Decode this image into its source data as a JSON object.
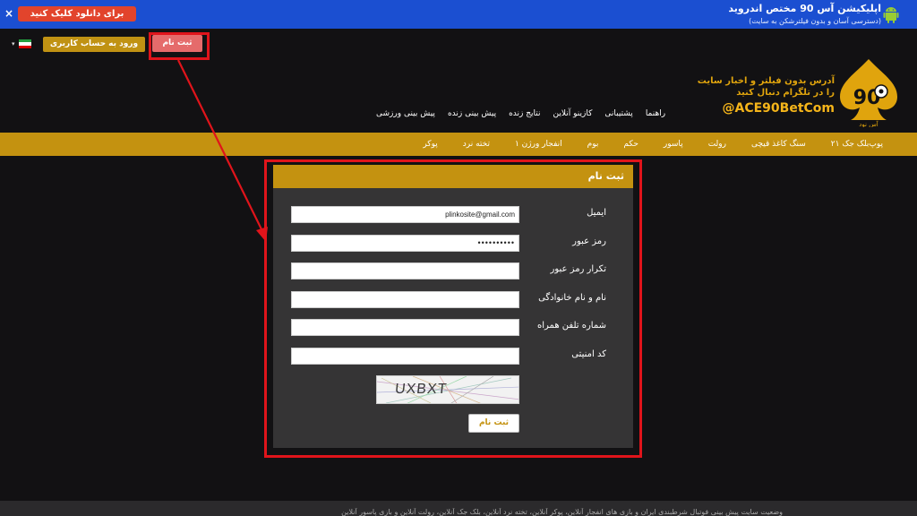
{
  "app_banner": {
    "title": "اپلیکیشن آس 90 مختص اندروید",
    "subtitle": "(دسترسی آسان و بدون فیلترشکن به سایت)",
    "download_button": "برای دانلود کلیک کنید",
    "close_glyph": "×",
    "bg_color": "#1b4fd1"
  },
  "header": {
    "register_button": "ثبت نام",
    "login_button": "ورود به حساب کاربری",
    "language_caret": "▾",
    "logo": {
      "line1": "آدرس بدون فیلتر و اخبار سایت",
      "line2": "را در تلگرام دنبال کنید",
      "handle": "@ACE90BetCom",
      "brand_text": "آس نود"
    },
    "nav": [
      "پیش بینی ورزشی",
      "پیش بینی زنده",
      "نتایج زنده",
      "کازینو آنلاین",
      "پشتیبانی",
      "راهنما"
    ]
  },
  "game_menu": [
    "پوکر",
    "تخته نرد",
    "انفجار ورژن ۱",
    "بوم",
    "حکم",
    "پاسور",
    "رولت",
    "سنگ کاغذ قیچی",
    "بلک جک ۲۱",
    "پوپ"
  ],
  "form": {
    "title": "ثبت نام",
    "fields": [
      {
        "label": "ایمیل",
        "value": "plinkosite@gmail.com"
      },
      {
        "label": "رمز عبور",
        "value": "••••••••••"
      },
      {
        "label": "تکرار رمز عبور",
        "value": ""
      },
      {
        "label": "نام و نام خانوادگی",
        "value": ""
      },
      {
        "label": "شماره تلفن همراه",
        "value": ""
      },
      {
        "label": "کد امنیتی",
        "value": ""
      }
    ],
    "captcha_text": "UXBXT",
    "submit_button": "ثبت نام"
  },
  "footer": {
    "text": "وضعیت سایت پیش بینی فوتبال شرطبندی ایران و بازی های انفجار آنلاین، پوکر آنلاین، تخته نرد آنلاین، بلک جک آنلاین، رولت آنلاین و بازی پاسور آنلاین"
  },
  "colors": {
    "gold": "#c49210",
    "highlight": "#e0141b",
    "background": "#121113",
    "form_bg": "#353435"
  }
}
